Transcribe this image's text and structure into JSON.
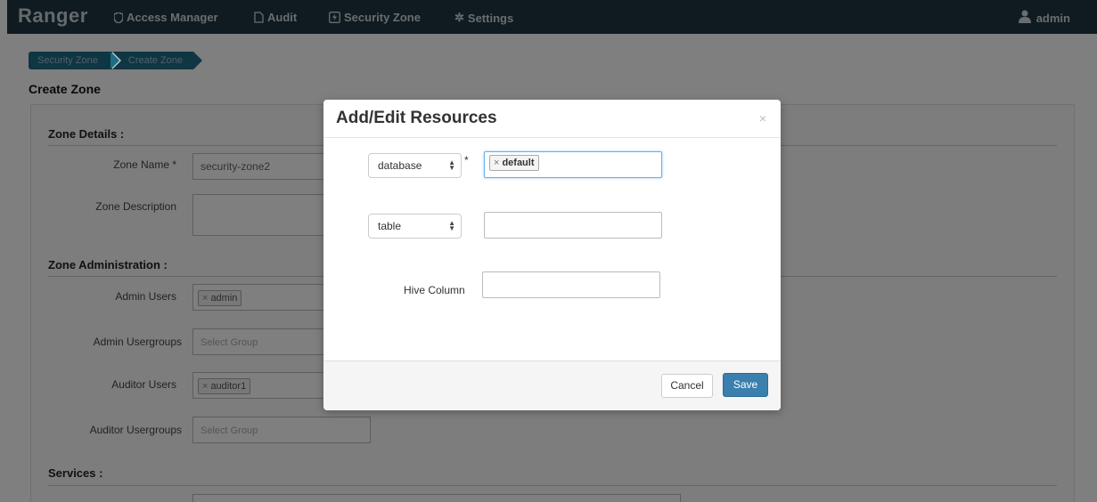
{
  "navbar": {
    "brand": "Ranger",
    "items": [
      {
        "label": "Access Manager",
        "icon": "shield-icon"
      },
      {
        "label": "Audit",
        "icon": "file-icon"
      },
      {
        "label": "Security Zone",
        "icon": "bolt-icon"
      },
      {
        "label": "Settings",
        "icon": "gear-icon"
      }
    ],
    "user": "admin"
  },
  "breadcrumb": [
    "Security Zone",
    "Create Zone"
  ],
  "page_title": "Create Zone",
  "form": {
    "zone_details_heading": "Zone Details :",
    "zone_name_label": "Zone Name *",
    "zone_name_value": "security-zone2",
    "zone_description_label": "Zone Description",
    "zone_admin_heading": "Zone Administration :",
    "admin_users_label": "Admin Users",
    "admin_users_tag": "admin",
    "admin_usergroups_label": "Admin Usergroups",
    "admin_usergroups_placeholder": "Select Group",
    "auditor_users_label": "Auditor Users",
    "auditor_users_tag": "auditor1",
    "auditor_usergroups_label": "Auditor Usergroups",
    "auditor_usergroups_placeholder": "Select Group",
    "services_heading": "Services :"
  },
  "modal": {
    "title": "Add/Edit Resources",
    "close": "×",
    "resource1_select": "database",
    "required_mark": "*",
    "resource1_tag": "default",
    "resource2_select": "table",
    "hive_column_label": "Hive Column",
    "cancel_label": "Cancel",
    "save_label": "Save"
  }
}
